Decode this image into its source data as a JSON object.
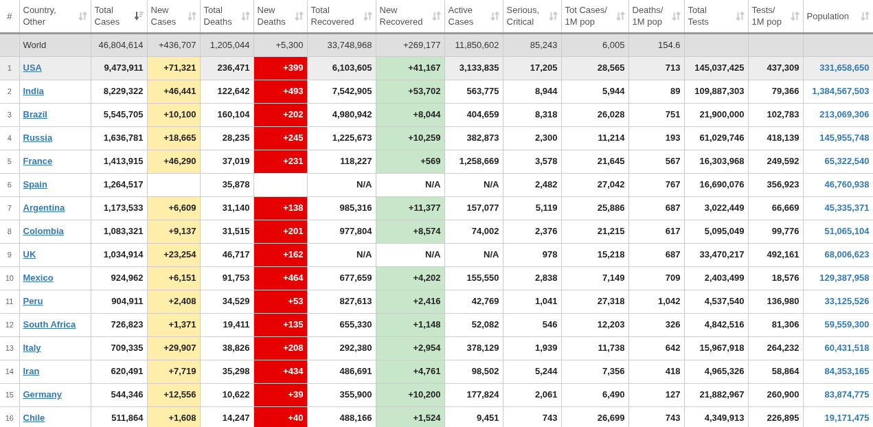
{
  "table": {
    "columns": [
      {
        "label": "#"
      },
      {
        "label": "Country,\nOther",
        "sorted": false
      },
      {
        "label": "Total\nCases",
        "sorted": true
      },
      {
        "label": "New\nCases",
        "sorted": false
      },
      {
        "label": "Total\nDeaths",
        "sorted": false
      },
      {
        "label": "New\nDeaths",
        "sorted": false
      },
      {
        "label": "Total\nRecovered",
        "sorted": false
      },
      {
        "label": "New\nRecovered",
        "sorted": false
      },
      {
        "label": "Active\nCases",
        "sorted": false
      },
      {
        "label": "Serious,\nCritical",
        "sorted": false
      },
      {
        "label": "Tot Cases/\n1M pop",
        "sorted": false
      },
      {
        "label": "Deaths/\n1M pop",
        "sorted": false
      },
      {
        "label": "Total\nTests",
        "sorted": false
      },
      {
        "label": "Tests/\n1M pop",
        "sorted": false
      },
      {
        "label": "Population",
        "sorted": false
      }
    ],
    "total_row": {
      "label": "World",
      "total_cases": "46,804,614",
      "new_cases": "+436,707",
      "total_deaths": "1,205,044",
      "new_deaths": "+5,300",
      "total_recovered": "33,748,968",
      "new_recovered": "+269,177",
      "active_cases": "11,850,602",
      "serious_critical": "85,243",
      "cases_per_1m": "6,005",
      "deaths_per_1m": "154.6"
    },
    "rows": [
      {
        "rank": "1",
        "country": "USA",
        "hovered": true,
        "new_cases_highlighted": true,
        "new_deaths_highlighted": true,
        "new_recovered_highlighted": true,
        "total_cases": "9,473,911",
        "new_cases": "+71,321",
        "total_deaths": "236,471",
        "new_deaths": "+399",
        "total_recovered": "6,103,605",
        "new_recovered": "+41,167",
        "active_cases": "3,133,835",
        "serious_critical": "17,205",
        "cases_per_1m": "28,565",
        "deaths_per_1m": "713",
        "total_tests": "145,037,425",
        "tests_per_1m": "437,309",
        "population": "331,658,650"
      },
      {
        "rank": "2",
        "country": "India",
        "hovered": false,
        "new_cases_highlighted": true,
        "new_deaths_highlighted": true,
        "new_recovered_highlighted": true,
        "total_cases": "8,229,322",
        "new_cases": "+46,441",
        "total_deaths": "122,642",
        "new_deaths": "+493",
        "total_recovered": "7,542,905",
        "new_recovered": "+53,702",
        "active_cases": "563,775",
        "serious_critical": "8,944",
        "cases_per_1m": "5,944",
        "deaths_per_1m": "89",
        "total_tests": "109,887,303",
        "tests_per_1m": "79,366",
        "population": "1,384,567,503"
      },
      {
        "rank": "3",
        "country": "Brazil",
        "hovered": false,
        "new_cases_highlighted": true,
        "new_deaths_highlighted": true,
        "new_recovered_highlighted": true,
        "total_cases": "5,545,705",
        "new_cases": "+10,100",
        "total_deaths": "160,104",
        "new_deaths": "+202",
        "total_recovered": "4,980,942",
        "new_recovered": "+8,044",
        "active_cases": "404,659",
        "serious_critical": "8,318",
        "cases_per_1m": "26,028",
        "deaths_per_1m": "751",
        "total_tests": "21,900,000",
        "tests_per_1m": "102,783",
        "population": "213,069,306"
      },
      {
        "rank": "4",
        "country": "Russia",
        "hovered": false,
        "new_cases_highlighted": true,
        "new_deaths_highlighted": true,
        "new_recovered_highlighted": true,
        "total_cases": "1,636,781",
        "new_cases": "+18,665",
        "total_deaths": "28,235",
        "new_deaths": "+245",
        "total_recovered": "1,225,673",
        "new_recovered": "+10,259",
        "active_cases": "382,873",
        "serious_critical": "2,300",
        "cases_per_1m": "11,214",
        "deaths_per_1m": "193",
        "total_tests": "61,029,746",
        "tests_per_1m": "418,139",
        "population": "145,955,748"
      },
      {
        "rank": "5",
        "country": "France",
        "hovered": false,
        "new_cases_highlighted": true,
        "new_deaths_highlighted": true,
        "new_recovered_highlighted": true,
        "total_cases": "1,413,915",
        "new_cases": "+46,290",
        "total_deaths": "37,019",
        "new_deaths": "+231",
        "total_recovered": "118,227",
        "new_recovered": "+569",
        "active_cases": "1,258,669",
        "serious_critical": "3,578",
        "cases_per_1m": "21,645",
        "deaths_per_1m": "567",
        "total_tests": "16,303,968",
        "tests_per_1m": "249,592",
        "population": "65,322,540"
      },
      {
        "rank": "6",
        "country": "Spain",
        "hovered": false,
        "new_cases_highlighted": false,
        "new_deaths_highlighted": false,
        "new_recovered_highlighted": false,
        "total_cases": "1,264,517",
        "total_deaths": "35,878",
        "total_recovered": "N/A",
        "new_recovered": "N/A",
        "active_cases": "N/A",
        "serious_critical": "2,482",
        "cases_per_1m": "27,042",
        "deaths_per_1m": "767",
        "total_tests": "16,690,076",
        "tests_per_1m": "356,923",
        "population": "46,760,938"
      },
      {
        "rank": "7",
        "country": "Argentina",
        "hovered": false,
        "new_cases_highlighted": true,
        "new_deaths_highlighted": true,
        "new_recovered_highlighted": true,
        "total_cases": "1,173,533",
        "new_cases": "+6,609",
        "total_deaths": "31,140",
        "new_deaths": "+138",
        "total_recovered": "985,316",
        "new_recovered": "+11,377",
        "active_cases": "157,077",
        "serious_critical": "5,119",
        "cases_per_1m": "25,886",
        "deaths_per_1m": "687",
        "total_tests": "3,022,449",
        "tests_per_1m": "66,669",
        "population": "45,335,371"
      },
      {
        "rank": "8",
        "country": "Colombia",
        "hovered": false,
        "new_cases_highlighted": true,
        "new_deaths_highlighted": true,
        "new_recovered_highlighted": true,
        "total_cases": "1,083,321",
        "new_cases": "+9,137",
        "total_deaths": "31,515",
        "new_deaths": "+201",
        "total_recovered": "977,804",
        "new_recovered": "+8,574",
        "active_cases": "74,002",
        "serious_critical": "2,376",
        "cases_per_1m": "21,215",
        "deaths_per_1m": "617",
        "total_tests": "5,095,049",
        "tests_per_1m": "99,776",
        "population": "51,065,104"
      },
      {
        "rank": "9",
        "country": "UK",
        "hovered": false,
        "new_cases_highlighted": true,
        "new_deaths_highlighted": true,
        "new_recovered_highlighted": false,
        "total_cases": "1,034,914",
        "new_cases": "+23,254",
        "total_deaths": "46,717",
        "new_deaths": "+162",
        "total_recovered": "N/A",
        "new_recovered": "N/A",
        "active_cases": "N/A",
        "serious_critical": "978",
        "cases_per_1m": "15,218",
        "deaths_per_1m": "687",
        "total_tests": "33,470,217",
        "tests_per_1m": "492,161",
        "population": "68,006,623"
      },
      {
        "rank": "10",
        "country": "Mexico",
        "hovered": false,
        "new_cases_highlighted": true,
        "new_deaths_highlighted": true,
        "new_recovered_highlighted": true,
        "total_cases": "924,962",
        "new_cases": "+6,151",
        "total_deaths": "91,753",
        "new_deaths": "+464",
        "total_recovered": "677,659",
        "new_recovered": "+4,202",
        "active_cases": "155,550",
        "serious_critical": "2,838",
        "cases_per_1m": "7,149",
        "deaths_per_1m": "709",
        "total_tests": "2,403,499",
        "tests_per_1m": "18,576",
        "population": "129,387,958"
      },
      {
        "rank": "11",
        "country": "Peru",
        "hovered": false,
        "new_cases_highlighted": true,
        "new_deaths_highlighted": true,
        "new_recovered_highlighted": true,
        "total_cases": "904,911",
        "new_cases": "+2,408",
        "total_deaths": "34,529",
        "new_deaths": "+53",
        "total_recovered": "827,613",
        "new_recovered": "+2,416",
        "active_cases": "42,769",
        "serious_critical": "1,041",
        "cases_per_1m": "27,318",
        "deaths_per_1m": "1,042",
        "total_tests": "4,537,540",
        "tests_per_1m": "136,980",
        "population": "33,125,526"
      },
      {
        "rank": "12",
        "country": "South Africa",
        "hovered": false,
        "new_cases_highlighted": true,
        "new_deaths_highlighted": true,
        "new_recovered_highlighted": true,
        "total_cases": "726,823",
        "new_cases": "+1,371",
        "total_deaths": "19,411",
        "new_deaths": "+135",
        "total_recovered": "655,330",
        "new_recovered": "+1,148",
        "active_cases": "52,082",
        "serious_critical": "546",
        "cases_per_1m": "12,203",
        "deaths_per_1m": "326",
        "total_tests": "4,842,516",
        "tests_per_1m": "81,306",
        "population": "59,559,300"
      },
      {
        "rank": "13",
        "country": "Italy",
        "hovered": false,
        "new_cases_highlighted": true,
        "new_deaths_highlighted": true,
        "new_recovered_highlighted": true,
        "total_cases": "709,335",
        "new_cases": "+29,907",
        "total_deaths": "38,826",
        "new_deaths": "+208",
        "total_recovered": "292,380",
        "new_recovered": "+2,954",
        "active_cases": "378,129",
        "serious_critical": "1,939",
        "cases_per_1m": "11,738",
        "deaths_per_1m": "642",
        "total_tests": "15,967,918",
        "tests_per_1m": "264,232",
        "population": "60,431,518"
      },
      {
        "rank": "14",
        "country": "Iran",
        "hovered": false,
        "new_cases_highlighted": true,
        "new_deaths_highlighted": true,
        "new_recovered_highlighted": true,
        "total_cases": "620,491",
        "new_cases": "+7,719",
        "total_deaths": "35,298",
        "new_deaths": "+434",
        "total_recovered": "486,691",
        "new_recovered": "+4,761",
        "active_cases": "98,502",
        "serious_critical": "5,244",
        "cases_per_1m": "7,356",
        "deaths_per_1m": "418",
        "total_tests": "4,965,326",
        "tests_per_1m": "58,864",
        "population": "84,353,165"
      },
      {
        "rank": "15",
        "country": "Germany",
        "hovered": false,
        "new_cases_highlighted": true,
        "new_deaths_highlighted": true,
        "new_recovered_highlighted": true,
        "total_cases": "544,346",
        "new_cases": "+12,556",
        "total_deaths": "10,622",
        "new_deaths": "+39",
        "total_recovered": "355,900",
        "new_recovered": "+10,200",
        "active_cases": "177,824",
        "serious_critical": "2,061",
        "cases_per_1m": "6,490",
        "deaths_per_1m": "127",
        "total_tests": "21,882,967",
        "tests_per_1m": "260,900",
        "population": "83,874,775"
      },
      {
        "rank": "16",
        "country": "Chile",
        "hovered": false,
        "new_cases_highlighted": true,
        "new_deaths_highlighted": true,
        "new_recovered_highlighted": true,
        "total_cases": "511,864",
        "new_cases": "+1,608",
        "total_deaths": "14,247",
        "new_deaths": "+40",
        "total_recovered": "488,166",
        "new_recovered": "+1,524",
        "active_cases": "9,451",
        "serious_critical": "743",
        "cases_per_1m": "26,699",
        "deaths_per_1m": "743",
        "total_tests": "4,349,913",
        "tests_per_1m": "226,895",
        "population": "19,171,475"
      }
    ]
  }
}
